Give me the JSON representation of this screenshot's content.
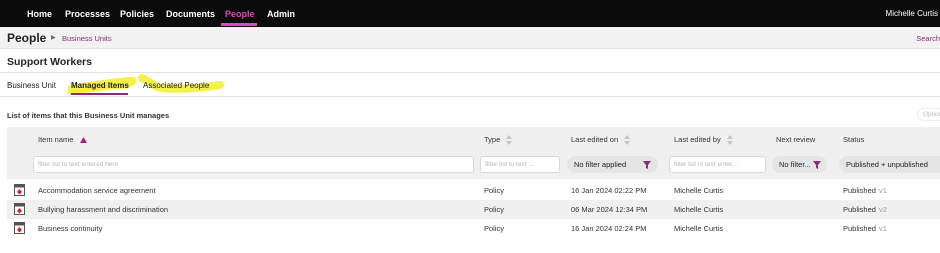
{
  "topnav": {
    "items": [
      "Home",
      "Processes",
      "Policies",
      "Documents",
      "People",
      "Admin"
    ],
    "active": "People",
    "user": "Michelle Curtis"
  },
  "subheader": {
    "title": "People",
    "breadcrumb": "Business Units",
    "search": "Search"
  },
  "section": {
    "title": "Support Workers"
  },
  "tabs": [
    "Business Unit",
    "Managed Items",
    "Associated People"
  ],
  "active_tab": "Managed Items",
  "list": {
    "caption": "List of items that this Business Unit manages",
    "ghost_button": "Options",
    "columns": [
      "Item name",
      "Type",
      "Last edited on",
      "Last edited by",
      "Next review",
      "Status"
    ],
    "filters": {
      "item_name_placeholder": "filter list to text entered here",
      "type_placeholder": "filter list to text ...",
      "last_edited_on": "No filter applied",
      "last_edited_by_placeholder": "filter list to text enter...",
      "next_review": "No filter...",
      "status": "Published + unpublished"
    },
    "rows": [
      {
        "name": "Accommodation service agreement",
        "type": "Policy",
        "edited_on": "16 Jan 2024 02:22 PM",
        "edited_by": "Michelle Curtis",
        "status": "Published",
        "version": "v1"
      },
      {
        "name": "Bullying harassment and discrimination",
        "type": "Policy",
        "edited_on": "06 Mar 2024 12:34 PM",
        "edited_by": "Michelle Curtis",
        "status": "Published",
        "version": "v2"
      },
      {
        "name": "Business continuity",
        "type": "Policy",
        "edited_on": "16 Jan 2024 02:24 PM",
        "edited_by": "Michelle Curtis",
        "status": "Published",
        "version": "v1"
      }
    ]
  },
  "colors": {
    "topbar": "#0b0b0b",
    "accent": "#d94bb5",
    "link": "#8a2c7a",
    "highlight": "#f5ee2a",
    "funnel": "#8a2c7a"
  }
}
